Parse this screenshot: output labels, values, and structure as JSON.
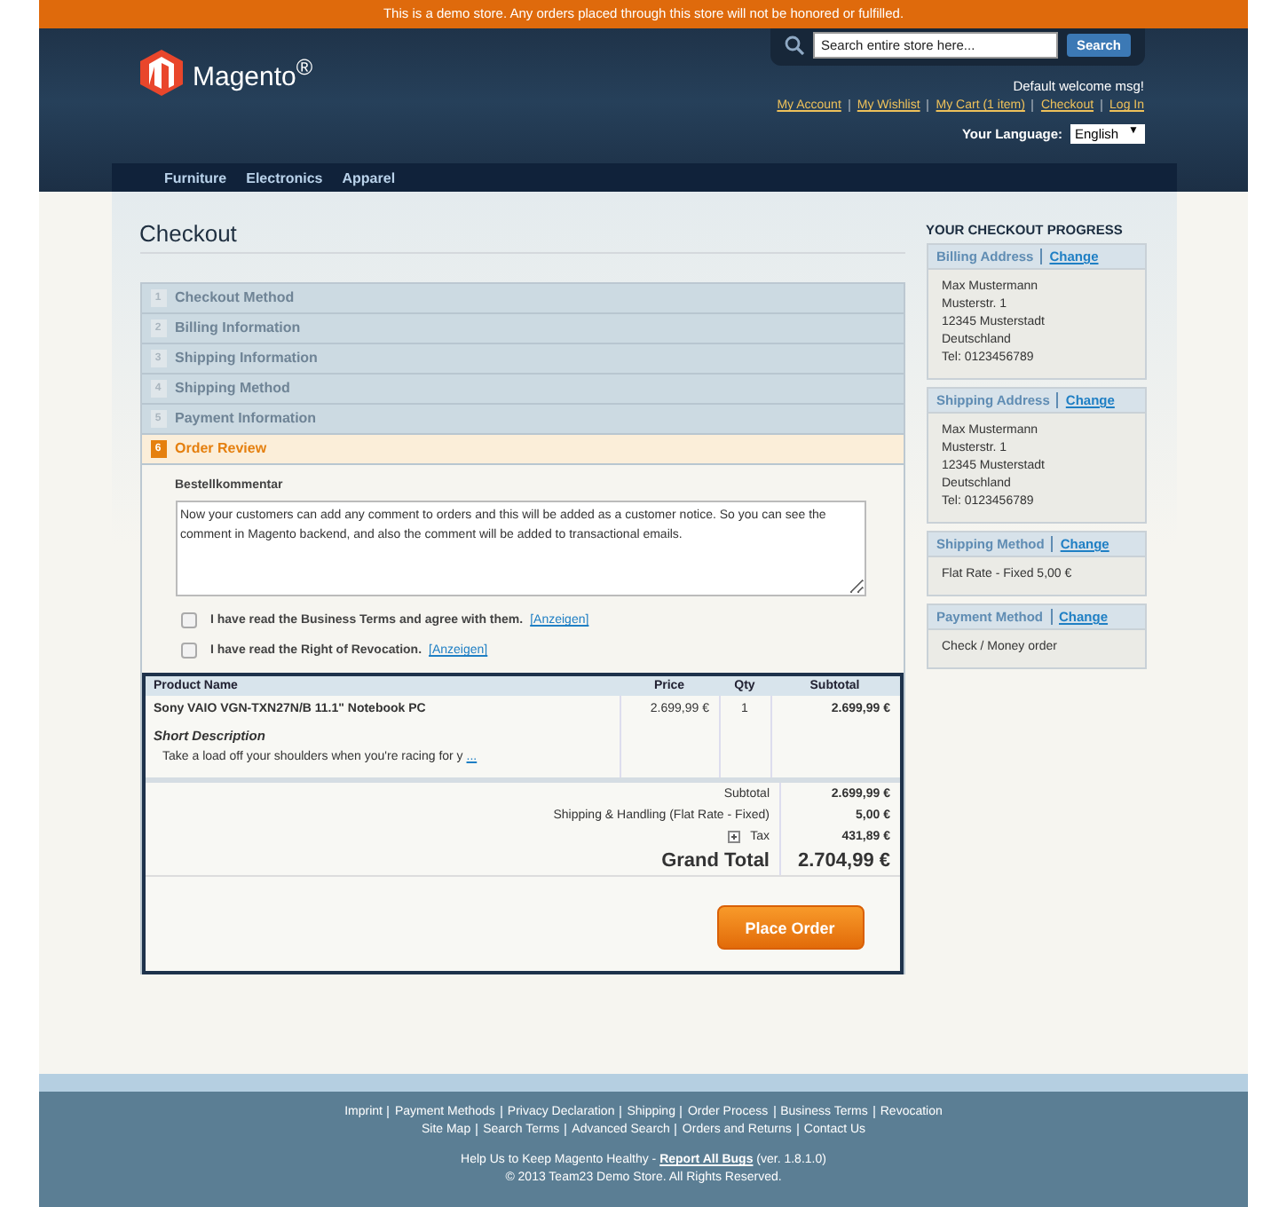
{
  "notice": "This is a demo store. Any orders placed through this store will not be honored or fulfilled.",
  "header": {
    "logo_text": "Magento$^{®}$",
    "search": {
      "placeholder": "Search entire store here...",
      "button": "Search"
    },
    "welcome": "Default welcome msg!",
    "links": [
      "My Account",
      "My Wishlist",
      "My Cart (1 item)",
      "Checkout",
      "Log In"
    ],
    "language": {
      "label": "Your Language:",
      "value": "English",
      "arrow": "▼"
    }
  },
  "nav": [
    "Furniture",
    "Electronics",
    "Apparel"
  ],
  "page_title": "Checkout",
  "steps": [
    {
      "number": "1",
      "label": "Checkout Method",
      "selected": false
    },
    {
      "number": "2",
      "label": "Billing Information",
      "selected": false
    },
    {
      "number": "3",
      "label": "Shipping Information",
      "selected": false
    },
    {
      "number": "4",
      "label": "Shipping Method",
      "selected": false
    },
    {
      "number": "5",
      "label": "Payment Information",
      "selected": false
    },
    {
      "number": "6",
      "label": "Order Review",
      "selected": true
    }
  ],
  "comment": {
    "label": "Bestellkommentar",
    "value": "Now your customers can add any comment to orders and this will be added as a customer notice. So you can see the comment in Magento backend, and also the comment will be added to transactional emails."
  },
  "agreements": [
    {
      "text": "I have read the Business Terms and agree with them.",
      "link": "[Anzeigen]",
      "checked": false
    },
    {
      "text": "I have read the Right of Revocation.",
      "link": "[Anzeigen]",
      "checked": false
    }
  ],
  "table": {
    "columns": [
      "Product Name",
      "Price",
      "Qty",
      "Subtotal"
    ],
    "rows": [
      {
        "name": "Sony VAIO VGN-TXN27N/B 11.1\" Notebook PC",
        "desc_title": "Short Description",
        "desc": "Take a load off your shoulders when you're racing for y",
        "more": "...",
        "price": "2.699,99 €",
        "qty": "1",
        "subtotal": "2.699,99 €"
      }
    ],
    "totals": [
      {
        "label": "Subtotal",
        "value": "2.699,99 €",
        "kind": "plain"
      },
      {
        "label": "Shipping & Handling (Flat Rate - Fixed)",
        "value": "5,00 €",
        "kind": "plain"
      },
      {
        "label": "Tax",
        "value": "431,89 €",
        "kind": "tax"
      },
      {
        "label": "Grand Total",
        "value": "2.704,99 €",
        "kind": "grand"
      }
    ]
  },
  "place_order": "Place Order",
  "progress": {
    "title": "YOUR CHECKOUT PROGRESS",
    "boxes": [
      {
        "title": "Billing Address",
        "change": "Change",
        "lines": [
          "Max Mustermann",
          "Musterstr. 1",
          "12345 Musterstadt",
          "Deutschland",
          "Tel: 0123456789"
        ]
      },
      {
        "title": "Shipping Address",
        "change": "Change",
        "lines": [
          "Max Mustermann",
          "Musterstr. 1",
          "12345 Musterstadt",
          "Deutschland",
          "Tel: 0123456789"
        ]
      },
      {
        "title": "Shipping Method",
        "change": "Change",
        "lines": [
          "Flat Rate - Fixed 5,00 €"
        ]
      },
      {
        "title": "Payment Method",
        "change": "Change",
        "lines": [
          "Check / Money order"
        ]
      }
    ]
  },
  "footer": {
    "links": [
      [
        "Imprint",
        "Payment Methods",
        "Privacy Declaration",
        "Shipping",
        "Order Process",
        "Business Terms",
        "Revocation"
      ],
      [
        "Site Map",
        "Search Terms",
        "Advanced Search",
        "Orders and Returns",
        "Contact Us"
      ]
    ],
    "help": "Help Us to Keep Magento Healthy - ",
    "bugs": "Report All Bugs",
    "version": " (ver. 1.8.1.0)",
    "copyright": "© 2013 Team23 Demo Store. All Rights Reserved."
  }
}
